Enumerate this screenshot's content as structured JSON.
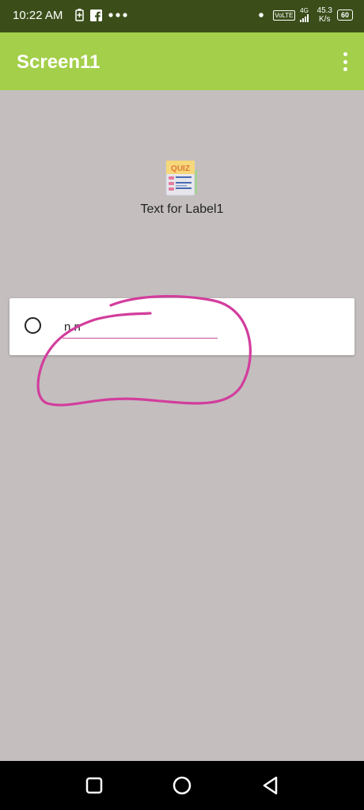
{
  "status_bar": {
    "time": "10:22 AM",
    "left_icons": [
      "battery-saver-icon",
      "facebook-icon",
      "more-notifications-icon"
    ],
    "network_speed": "45.3",
    "network_unit": "K/s",
    "volte": "VoLTE",
    "net_type": "4G",
    "battery": "60"
  },
  "app_bar": {
    "title": "Screen11",
    "menu_icon": "more-vert-icon",
    "color": "#a4cf4a"
  },
  "main": {
    "image_icon": "quiz-icon",
    "label1": "Text for Label1",
    "option_value": "n n",
    "background": "#c4bebf"
  },
  "annotation": {
    "color": "#d23d9c",
    "shape": "hand-drawn circle"
  },
  "nav_bar": {
    "buttons": [
      "recents-button",
      "home-button",
      "back-button"
    ]
  }
}
